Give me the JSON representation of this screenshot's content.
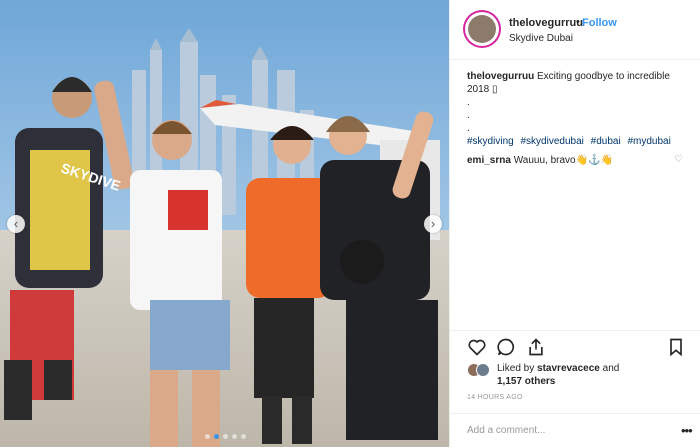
{
  "post": {
    "username": "thelovegurruu",
    "follow_label": "Follow",
    "separator": "•",
    "location": "Skydive Dubai",
    "caption_line1": "Exciting goodbye to incredible",
    "caption_line2": "2018 ▯",
    "caption_dots": [
      ".",
      ".",
      "."
    ],
    "hashtags": [
      "#skydiving",
      "#skydivedubai",
      "#dubai",
      "#mydubai"
    ],
    "comment": {
      "username": "emi_srna",
      "text": "Wauuu, bravo👋⚓👋"
    },
    "likes": {
      "prefix": "Liked by",
      "user": "stavrevacece",
      "conj": "and",
      "count": "1,157 others"
    },
    "timestamp": "14 HOURS AGO",
    "add_comment_placeholder": "Add a comment...",
    "more_label": "•••",
    "photo_text": "SKYDIVE"
  },
  "colors": {
    "link": "#3897f0",
    "hashtag": "#003569",
    "text": "#262626",
    "muted": "#999999",
    "border": "#efefef"
  },
  "icons": [
    "heart-icon",
    "comment-icon",
    "share-icon",
    "bookmark-icon",
    "chevron-left-icon",
    "chevron-right-icon"
  ]
}
